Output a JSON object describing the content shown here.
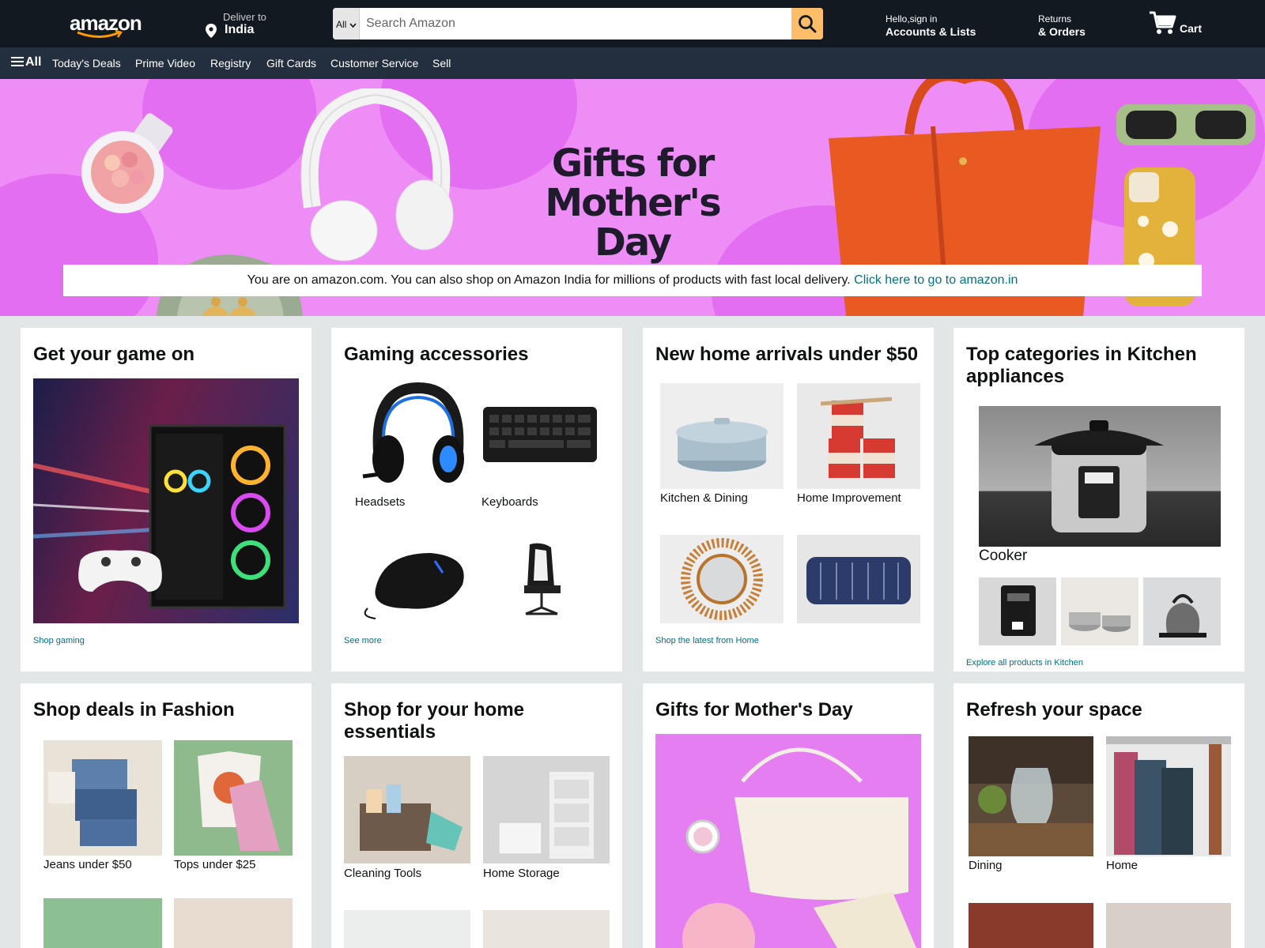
{
  "header": {
    "logo_text": "amazon",
    "deliver_line1": "Deliver to",
    "deliver_line2": "India",
    "search_category": "All",
    "search_placeholder": "Search Amazon",
    "account_line1": "Hello,sign in",
    "account_line2": "Accounts & Lists",
    "returns_line1": "Returns",
    "returns_line2": "& Orders",
    "cart_label": "Cart"
  },
  "nav": {
    "all_label": "All",
    "links": [
      "Today's Deals",
      "Prime Video",
      "Registry",
      "Gift Cards",
      "Customer Service",
      "Sell"
    ]
  },
  "hero": {
    "title_line1": "Gifts for",
    "title_line2": "Mother's Day",
    "notice_text": "You are on amazon.com. You can also shop on Amazon India for millions of products with fast local delivery.",
    "notice_link": "Click here to go to amazon.in"
  },
  "cards": [
    {
      "title": "Get your game on",
      "footer": "Shop gaming"
    },
    {
      "title": "Gaming accessories",
      "items": [
        "Headsets",
        "Keyboards"
      ],
      "footer": "See more"
    },
    {
      "title": "New home arrivals under $50",
      "items": [
        "Kitchen & Dining",
        "Home Improvement"
      ],
      "footer": "Shop the latest from Home"
    },
    {
      "title": "Top categories in Kitchen appliances",
      "items": [
        "Cooker"
      ],
      "footer": "Explore all products in Kitchen"
    },
    {
      "title": "Shop deals in Fashion",
      "items": [
        "Jeans under $50",
        "Tops under $25"
      ]
    },
    {
      "title": "Shop for your home essentials",
      "items": [
        "Cleaning Tools",
        "Home Storage"
      ]
    },
    {
      "title": "Gifts for Mother's Day"
    },
    {
      "title": "Refresh your space",
      "items": [
        "Dining",
        "Home"
      ]
    }
  ],
  "colors": {
    "nav_dark": "#131921",
    "nav_belt": "#232f3e",
    "search_button": "#febd69",
    "hero_bg": "#ef8df7",
    "link": "#007185"
  }
}
